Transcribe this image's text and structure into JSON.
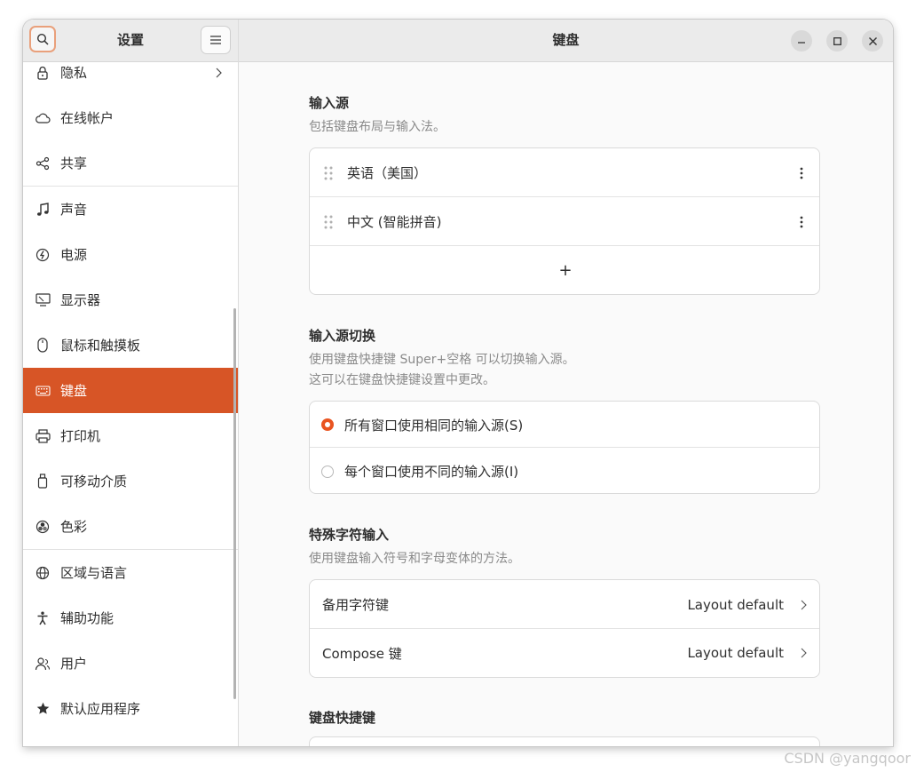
{
  "window": {
    "sidebar_title": "设置",
    "main_title": "键盘"
  },
  "sidebar": {
    "items": [
      {
        "label": "隐私",
        "icon": "lock-icon"
      },
      {
        "label": "在线帐户",
        "icon": "cloud-icon"
      },
      {
        "label": "共享",
        "icon": "share-icon"
      },
      {
        "label": "声音",
        "icon": "music-note-icon"
      },
      {
        "label": "电源",
        "icon": "power-icon"
      },
      {
        "label": "显示器",
        "icon": "display-icon"
      },
      {
        "label": "鼠标和触摸板",
        "icon": "mouse-icon"
      },
      {
        "label": "键盘",
        "icon": "keyboard-icon",
        "active": true
      },
      {
        "label": "打印机",
        "icon": "printer-icon"
      },
      {
        "label": "可移动介质",
        "icon": "removable-media-icon"
      },
      {
        "label": "色彩",
        "icon": "color-icon"
      },
      {
        "label": "区域与语言",
        "icon": "globe-icon"
      },
      {
        "label": "辅助功能",
        "icon": "accessibility-icon"
      },
      {
        "label": "用户",
        "icon": "users-icon"
      },
      {
        "label": "默认应用程序",
        "icon": "star-icon"
      }
    ]
  },
  "input_sources": {
    "title": "输入源",
    "description": "包括键盘布局与输入法。",
    "items": [
      "英语（美国）",
      "中文 (智能拼音)"
    ],
    "add_label": "+"
  },
  "switching": {
    "title": "输入源切换",
    "description_line1": "使用键盘快捷键 Super+空格 可以切换输入源。",
    "description_line2": "这可以在键盘快捷键设置中更改。",
    "option_same": "所有窗口使用相同的输入源(S)",
    "option_different": "每个窗口使用不同的输入源(I)",
    "selected": "same"
  },
  "special_chars": {
    "title": "特殊字符输入",
    "description": "使用键盘输入符号和字母变体的方法。",
    "rows": [
      {
        "label": "备用字符键",
        "value": "Layout default"
      },
      {
        "label": "Compose 键",
        "value": "Layout default"
      }
    ]
  },
  "shortcuts": {
    "title": "键盘快捷键"
  },
  "watermark": "CSDN @yangqoor",
  "colors": {
    "accent": "#e95420",
    "sidebar_active": "#d75526"
  }
}
